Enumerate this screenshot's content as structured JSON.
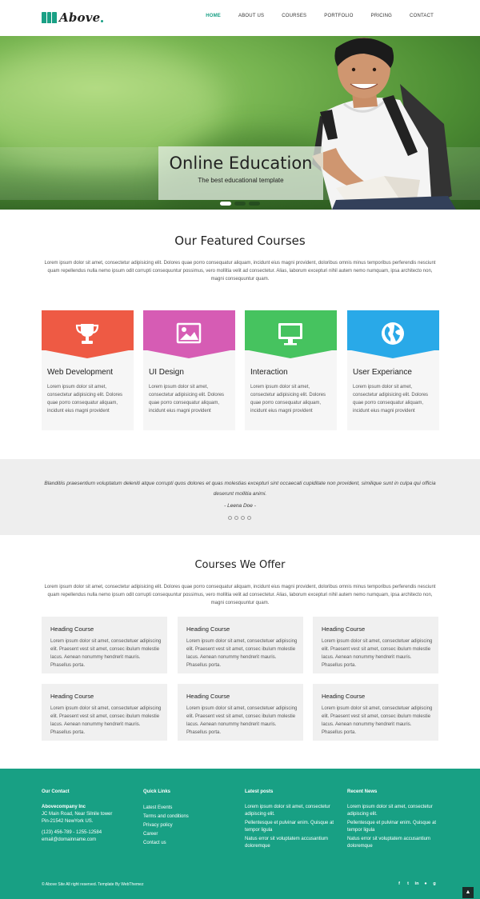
{
  "brand": {
    "name": "Above",
    "accent": "#1aa085"
  },
  "nav": {
    "items": [
      "HOME",
      "ABOUT US",
      "COURSES",
      "PORTFOLIO",
      "PRICING",
      "CONTACT"
    ],
    "active": "HOME"
  },
  "hero": {
    "title": "Online Education",
    "subtitle": "The best educational template",
    "slides": 3,
    "active_slide": 1
  },
  "featured": {
    "title": "Our Featured Courses",
    "intro": "Lorem ipsum dolor sit amet, consectetur adipisicing elit. Dolores quae porro consequatur aliquam, incidunt eius magni provident, doloribus omnis minus temporibus perferendis nesciunt quam repellendus nulla nemo ipsum odit corrupti consequuntur possimus, vero mollitia velit ad consectetur. Alias, laborum excepturi nihil autem nemo numquam, ipsa architecto non, magni consequuntur quam.",
    "cards": [
      {
        "title": "Web Development",
        "icon": "trophy-icon",
        "color": "#ee5a44",
        "text": "Lorem ipsum dolor sit amet, consectetur adipisicing elit. Dolores quae porro consequatur aliquam, incidunt eius magni provident"
      },
      {
        "title": "UI Design",
        "icon": "image-icon",
        "color": "#d65cb4",
        "text": "Lorem ipsum dolor sit amet, consectetur adipisicing elit. Dolores quae porro consequatur aliquam, incidunt eius magni provident"
      },
      {
        "title": "Interaction",
        "icon": "monitor-icon",
        "color": "#46c35f",
        "text": "Lorem ipsum dolor sit amet, consectetur adipisicing elit. Dolores quae porro consequatur aliquam, incidunt eius magni provident"
      },
      {
        "title": "User Experiance",
        "icon": "globe-icon",
        "color": "#29a9e8",
        "text": "Lorem ipsum dolor sit amet, consectetur adipisicing elit. Dolores quae porro consequatur aliquam, incidunt eius magni provident"
      }
    ]
  },
  "testimonial": {
    "quote": "Blanditiis praesentium voluptatum deleniti atque corrupti quos dolores et quas molestias excepturi sint occaecati cupiditate non provident, similique sunt in culpa qui officia deserunt mollitia animi.",
    "author": "- Leena Doe -",
    "dots": 4
  },
  "offer": {
    "title": "Courses We Offer",
    "intro": "Lorem ipsum dolor sit amet, consectetur adipisicing elit. Dolores quae porro consequatur aliquam, incidunt eius magni provident, doloribus omnis minus temporibus perferendis nesciunt quam repellendus nulla nemo ipsum odit corrupti consequuntur possimus, vero mollitia velit ad consectetur. Alias, laborum excepturi nihil autem nemo numquam, ipsa architecto non, magni consequuntur quam.",
    "courses": [
      {
        "title": "Heading Course",
        "text": "Lorem ipsum dolor sit amet, consectetuer adipiscing elit. Praesent vest sit amet, consec ibulum molestie lacus. Aenean nonummy hendrerit mauris. Phasellus porta."
      },
      {
        "title": "Heading Course",
        "text": "Lorem ipsum dolor sit amet, consectetuer adipiscing elit. Praesent vest sit amet, consec ibulum molestie lacus. Aenean nonummy hendrerit mauris. Phasellus porta."
      },
      {
        "title": "Heading Course",
        "text": "Lorem ipsum dolor sit amet, consectetuer adipiscing elit. Praesent vest sit amet, consec ibulum molestie lacus. Aenean nonummy hendrerit mauris. Phasellus porta."
      },
      {
        "title": "Heading Course",
        "text": "Lorem ipsum dolor sit amet, consectetuer adipiscing elit. Praesent vest sit amet, consec ibulum molestie lacus. Aenean nonummy hendrerit mauris. Phasellus porta."
      },
      {
        "title": "Heading Course",
        "text": "Lorem ipsum dolor sit amet, consectetuer adipiscing elit. Praesent vest sit amet, consec ibulum molestie lacus. Aenean nonummy hendrerit mauris. Phasellus porta."
      },
      {
        "title": "Heading Course",
        "text": "Lorem ipsum dolor sit amet, consectetuer adipiscing elit. Praesent vest sit amet, consec ibulum molestie lacus. Aenean nonummy hendrerit mauris. Phasellus porta."
      }
    ]
  },
  "footer": {
    "bg": "#18a084",
    "contact": {
      "heading": "Our Contact",
      "company": "Abovecompany Inc",
      "address1": "JC Main Road, Near Silnile tower",
      "address2": "Pin-21542 NewYork US.",
      "phone": "(123) 456-789 - 1255-12584",
      "email": "email@domainname.com"
    },
    "quick_links": {
      "heading": "Quick Links",
      "items": [
        "Latest Events",
        "Terms and conditions",
        "Privacy policy",
        "Career",
        "Contact us"
      ]
    },
    "latest_posts": {
      "heading": "Latest posts",
      "items": [
        "Lorem ipsum dolor sit amet, consectetur adipiscing elit.",
        "Pellentesque et pulvinar enim. Quisque at tempor ligula",
        "Natus error sit voluptatem accusantium doloremque"
      ]
    },
    "recent_news": {
      "heading": "Recent News",
      "items": [
        "Lorem ipsum dolor sit amet, consectetur adipiscing elit.",
        "Pellentesque et pulvinar enim. Quisque at tempor ligula",
        "Natus error sit voluptatem accusantium doloremque"
      ]
    },
    "copyright": "© Above Site All right reserved. Template By WebThemez",
    "social": [
      "facebook-icon",
      "twitter-icon",
      "linkedin-icon",
      "pinterest-icon",
      "google-plus-icon"
    ],
    "to_top": "back-to-top-icon"
  }
}
